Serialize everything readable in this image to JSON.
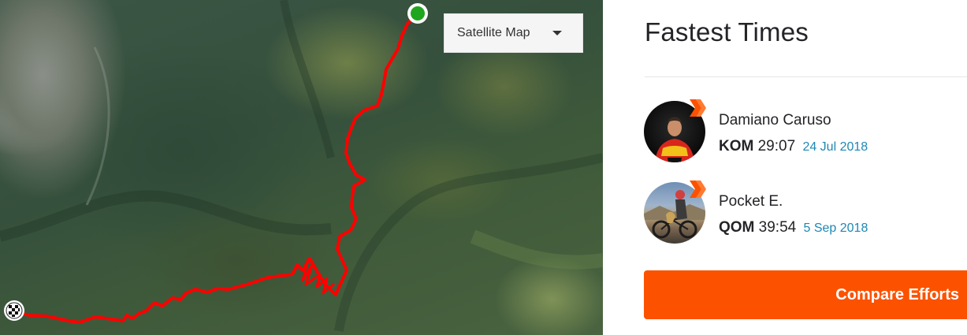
{
  "map": {
    "type_selector_label": "Satellite Map",
    "route_color": "#ff0000",
    "start_marker_color": "#1ea71e",
    "finish_marker": "checkered-flag-icon"
  },
  "leaderboard": {
    "title": "Fastest Times",
    "entries": [
      {
        "name": "Damiano Caruso",
        "label": "KOM",
        "time": "29:07",
        "date": "24 Jul 2018"
      },
      {
        "name": "Pocket E.",
        "label": "QOM",
        "time": "39:54",
        "date": "5 Sep 2018"
      }
    ],
    "compare_label": "Compare Efforts",
    "accent": "#fc5200",
    "date_color": "#1e88b4"
  }
}
